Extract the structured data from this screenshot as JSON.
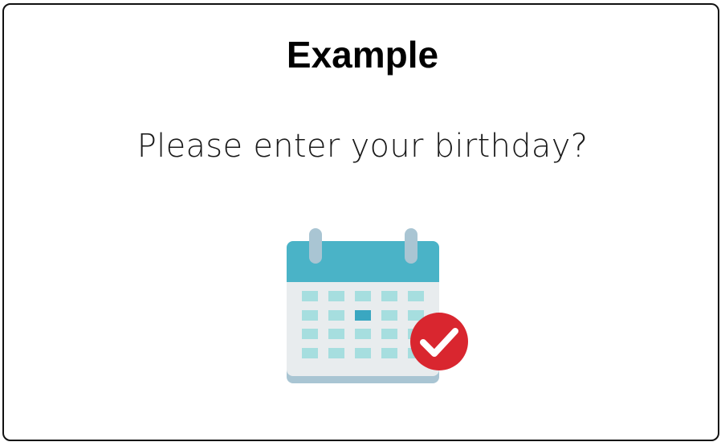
{
  "card": {
    "title": "Example",
    "question": "Please enter your birthday?"
  },
  "icons": {
    "calendar": "calendar-check-icon",
    "check": "checkmark-badge-icon"
  },
  "colors": {
    "calendar_header": "#4AB3C7",
    "calendar_body": "#E8ECEE",
    "calendar_base": "#A9C5D3",
    "calendar_rings": "#A9C5D3",
    "day_cells": "#A6DEDF",
    "selected_day": "#3AA7C1",
    "check_badge": "#D9262F",
    "check_mark": "#FFFFFF"
  }
}
